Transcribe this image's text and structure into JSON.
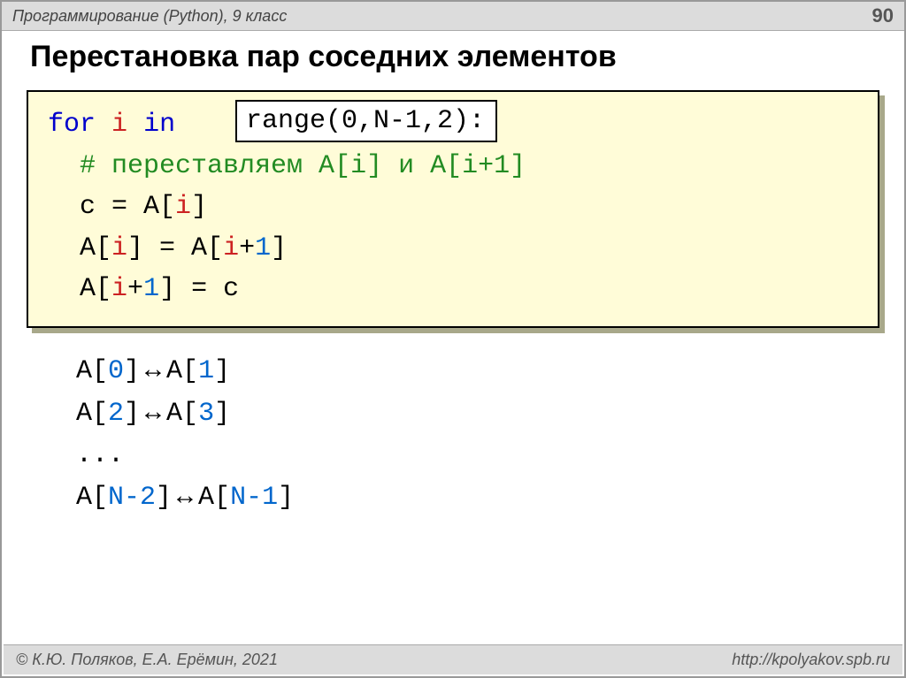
{
  "header": {
    "title": "Программирование (Python), 9 класс",
    "pageNumber": "90"
  },
  "title": "Перестановка пар соседних элементов",
  "code": {
    "kw_for": "for",
    "i_first": "i",
    "kw_in": "in",
    "range_text": "range(0,N-1,2):",
    "comment_prefix": "# переставляем A[",
    "comment_i1": "i",
    "comment_mid": "] и A[",
    "comment_i2": "i",
    "comment_plus1": "+1",
    "comment_end": "]",
    "l3_a": "c = A[",
    "l3_i": "i",
    "l3_b": "]",
    "l4_a": "A[",
    "l4_i1": "i",
    "l4_b": "] = A[",
    "l4_i2": "i",
    "l4_plus": "+",
    "l4_one": "1",
    "l4_c": "]",
    "l5_a": "A[",
    "l5_i": "i",
    "l5_plus": "+",
    "l5_one": "1",
    "l5_b": "] = c"
  },
  "swaps": {
    "r1_a": "A[",
    "r1_n1": "0",
    "r1_b": "]",
    "arrow": "↔",
    "r1_c": "A[",
    "r1_n2": "1",
    "r1_d": "]",
    "r2_a": "A[",
    "r2_n1": "2",
    "r2_b": "]",
    "r2_c": "A[",
    "r2_n2": "3",
    "r2_d": "]",
    "dots": "...",
    "r4_a": "A[",
    "r4_n1": "N-2",
    "r4_b": "]",
    "r4_c": "A[",
    "r4_n2": "N-1",
    "r4_d": "]"
  },
  "footer": {
    "copyright": "© К.Ю. Поляков, Е.А. Ерёмин, 2021",
    "url": "http://kpolyakov.spb.ru"
  }
}
